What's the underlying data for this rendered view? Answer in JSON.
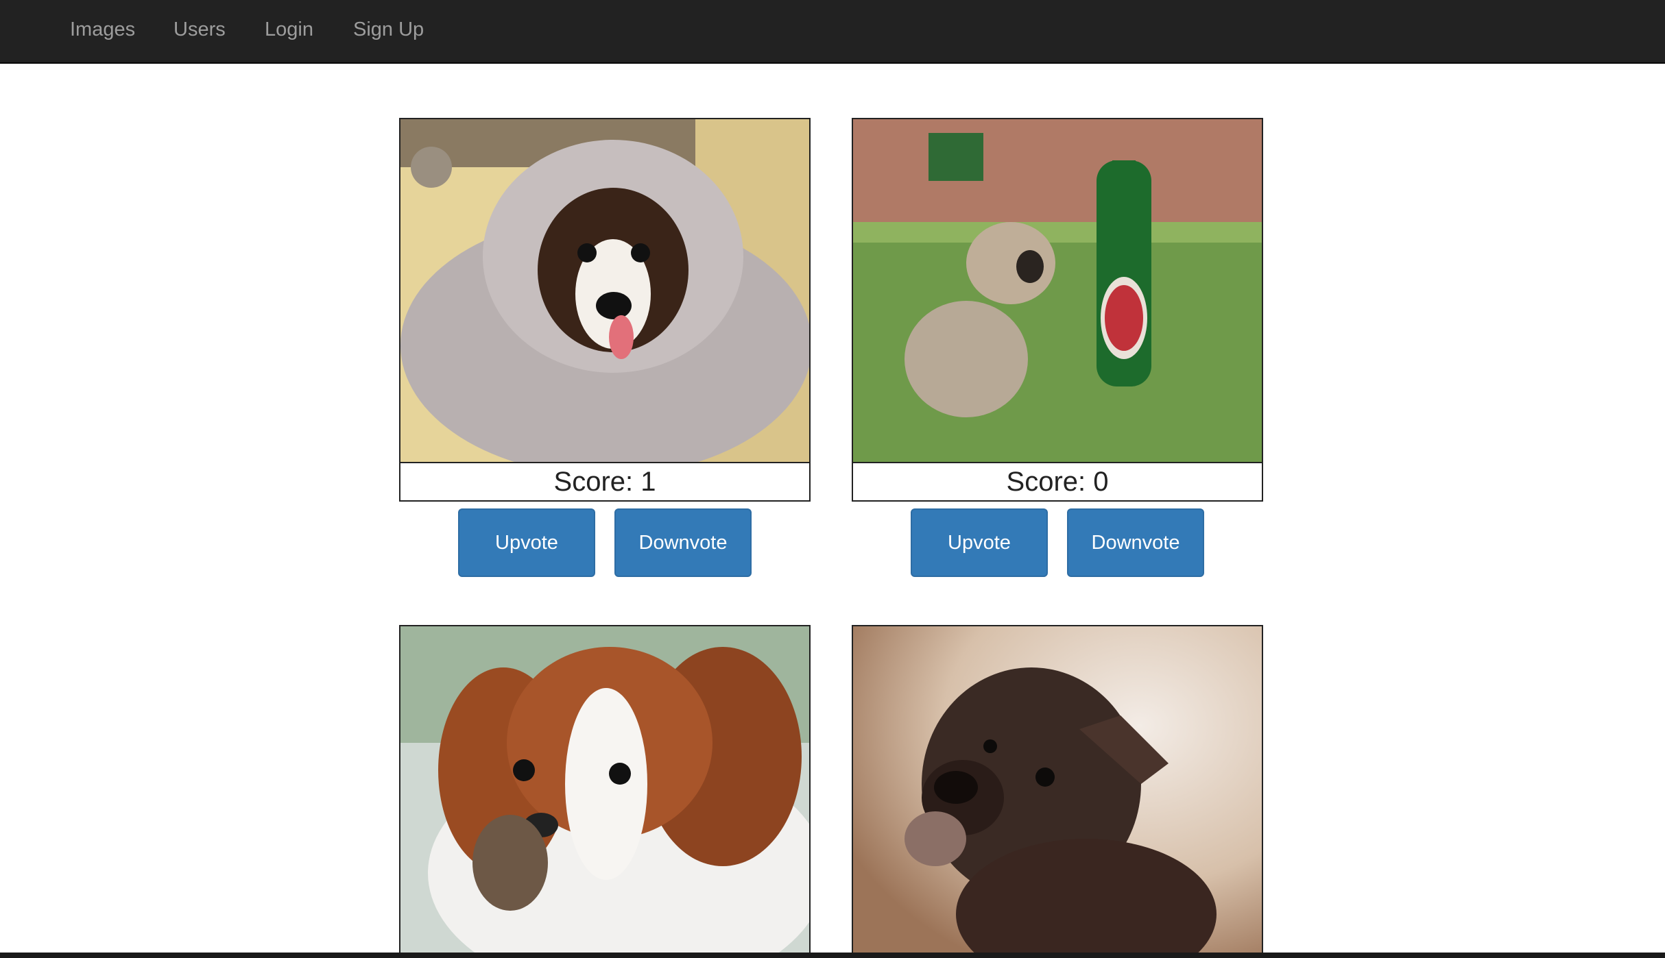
{
  "navbar": {
    "links": [
      {
        "label": "Images"
      },
      {
        "label": "Users"
      },
      {
        "label": "Login"
      },
      {
        "label": "Sign Up"
      }
    ]
  },
  "colors": {
    "navbar_bg": "#222222",
    "nav_link": "#9d9d9d",
    "button_bg": "#337ab7",
    "button_text": "#ffffff"
  },
  "images": [
    {
      "photo": "puppy-wrapped-in-towel",
      "score_text": "Score: 1",
      "upvote_label": "Upvote",
      "downvote_label": "Downvote"
    },
    {
      "photo": "pug-with-beer-bottle",
      "score_text": "Score: 0",
      "upvote_label": "Upvote",
      "downvote_label": "Downvote"
    },
    {
      "photo": "spaniel-puppy-with-pinecone"
    },
    {
      "photo": "boxer-puppy-looking-up"
    }
  ]
}
